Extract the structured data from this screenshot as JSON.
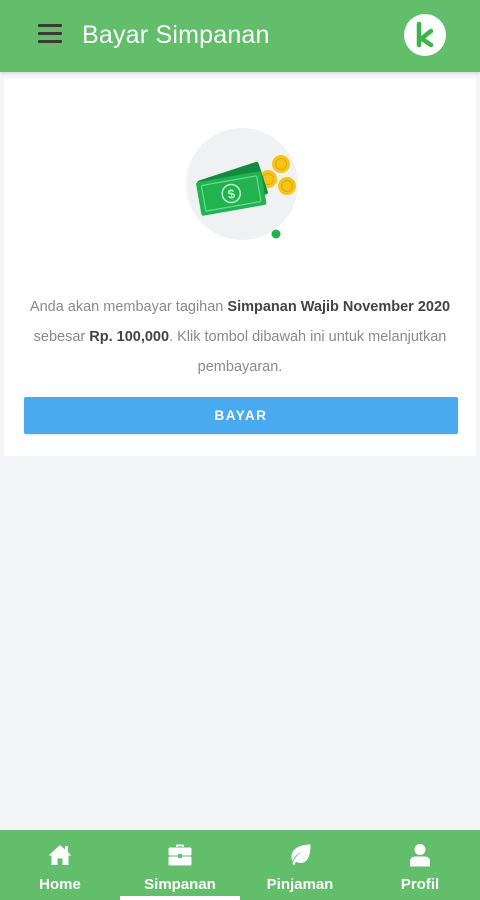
{
  "header": {
    "title": "Bayar Simpanan",
    "menu_icon": "hamburger-menu-icon",
    "logo_letter": "k",
    "logo_icon": "app-logo-k-icon"
  },
  "payment": {
    "illustration_icon": "money-bills-coins-icon",
    "message_prefix": "Anda akan membayar tagihan ",
    "bill_name": "Simpanan Wajib November 2020",
    "message_middle": " sebesar ",
    "amount": "Rp. 100,000",
    "message_suffix": ". Klik tombol dibawah ini untuk melanjutkan pembayaran.",
    "button_label": "BAYAR"
  },
  "bottom_nav": {
    "items": [
      {
        "label": "Home",
        "icon": "home-icon",
        "active": false
      },
      {
        "label": "Simpanan",
        "icon": "briefcase-icon",
        "active": true
      },
      {
        "label": "Pinjaman",
        "icon": "leaf-icon",
        "active": false
      },
      {
        "label": "Profil",
        "icon": "user-icon",
        "active": false
      }
    ]
  },
  "colors": {
    "primary_green": "#62be6a",
    "button_blue": "#4aaaf0",
    "background": "#f3f5f9",
    "money_green": "#1fa84f",
    "coin_gold": "#f5c518"
  }
}
